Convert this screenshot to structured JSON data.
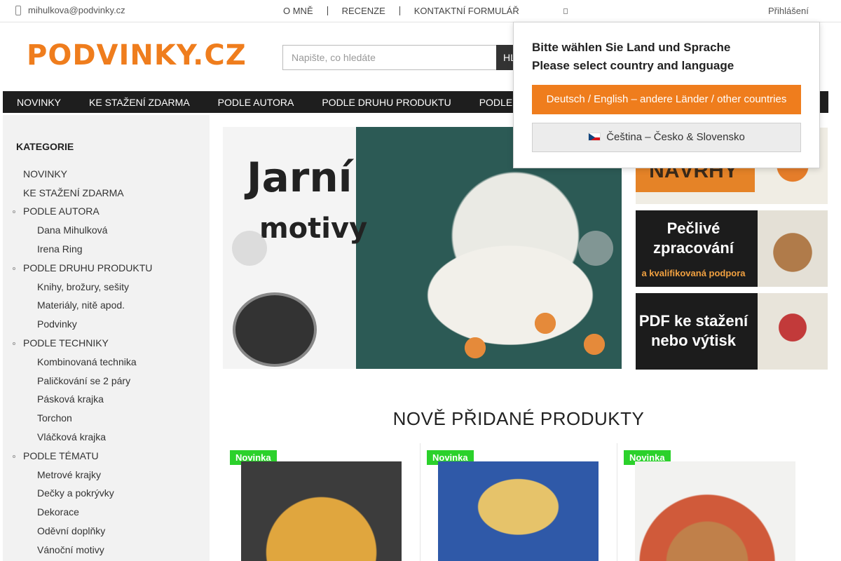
{
  "topbar": {
    "email": "mihulkova@podvinky.cz",
    "links": [
      "O MNĚ",
      "RECENZE",
      "KONTAKTNÍ FORMULÁŘ"
    ],
    "login": "Přihlášení"
  },
  "header": {
    "logo": "PODVINKY.CZ",
    "search_placeholder": "Napište, co hledáte",
    "search_button": "HL"
  },
  "nav": {
    "items": [
      "NOVINKY",
      "KE STAŽENÍ ZDARMA",
      "PODLE AUTORA",
      "PODLE DRUHU PRODUKTU",
      "PODLE"
    ]
  },
  "sidebar": {
    "title": "KATEGORIE",
    "items": [
      {
        "label": "NOVINKY",
        "level": 0
      },
      {
        "label": "KE STAŽENÍ ZDARMA",
        "level": 0
      },
      {
        "label": "PODLE AUTORA",
        "level": 0
      },
      {
        "label": "Dana Mihulková",
        "level": 1
      },
      {
        "label": "Irena Ring",
        "level": 1
      },
      {
        "label": "PODLE DRUHU PRODUKTU",
        "level": 0
      },
      {
        "label": "Knihy, brožury, sešity",
        "level": 1
      },
      {
        "label": "Materiály, nitě apod.",
        "level": 1
      },
      {
        "label": "Podvinky",
        "level": 1
      },
      {
        "label": "PODLE TECHNIKY",
        "level": 0
      },
      {
        "label": "Kombinovaná technika",
        "level": 1
      },
      {
        "label": "Paličkování se 2 páry",
        "level": 1
      },
      {
        "label": "Pásková krajka",
        "level": 1
      },
      {
        "label": "Torchon",
        "level": 1
      },
      {
        "label": "Vláčková krajka",
        "level": 1
      },
      {
        "label": "PODLE TÉMATU",
        "level": 0
      },
      {
        "label": "Metrové krajky",
        "level": 1
      },
      {
        "label": "Dečky a pokrývky",
        "level": 1
      },
      {
        "label": "Dekorace",
        "level": 1
      },
      {
        "label": "Oděvní doplňky",
        "level": 1
      },
      {
        "label": "Vánoční motivy",
        "level": 1
      }
    ]
  },
  "slider": {
    "line1": "Jarní",
    "line2": "motivy"
  },
  "banners": [
    {
      "line1": "NÁVRHY",
      "line2": "",
      "line3": ""
    },
    {
      "line1": "Pečlivé",
      "line2": "zpracování",
      "line3": "a kvalifikovaná podpora"
    },
    {
      "line1": "PDF ke stažení",
      "line2": "nebo výtisk",
      "line3": ""
    }
  ],
  "section": {
    "title": "NOVĚ PŘIDANÉ PRODUKTY"
  },
  "products": [
    {
      "tag": "Novinka"
    },
    {
      "tag": "Novinka"
    },
    {
      "tag": "Novinka"
    }
  ],
  "popup": {
    "heading_de": "Bitte wählen Sie Land und Sprache",
    "heading_en": "Please select country and language",
    "button_de": "Deutsch / English – andere Länder / other countries",
    "button_cz": "Čeština – Česko & Slovensko"
  },
  "colors": {
    "brand_orange": "#ef7d1d",
    "nav_bg": "#1e1e1e",
    "new_tag": "#2bd12b"
  }
}
